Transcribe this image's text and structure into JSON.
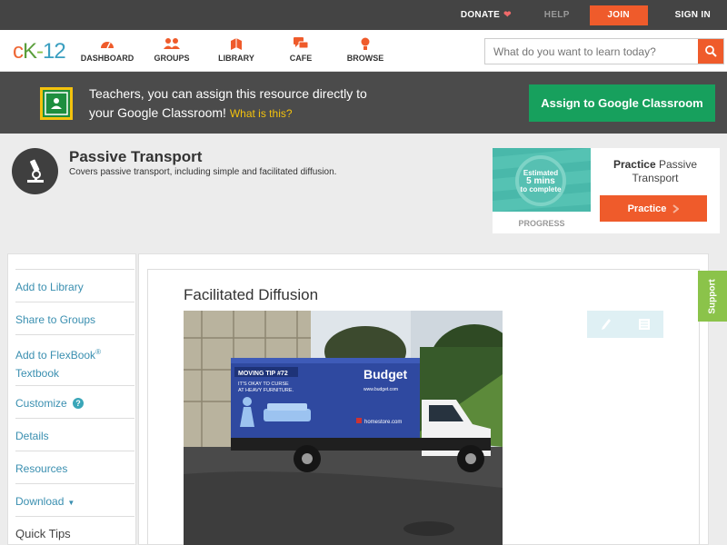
{
  "topbar": {
    "donate": "DONATE",
    "help": "HELP",
    "join": "JOIN",
    "sign_in": "SIGN IN"
  },
  "logo": {
    "part1": "c",
    "part2": "K",
    "part3": "-",
    "part4": "12"
  },
  "nav": {
    "items": [
      {
        "label": "DASHBOARD",
        "icon": "dashboard-icon"
      },
      {
        "label": "GROUPS",
        "icon": "groups-icon"
      },
      {
        "label": "LIBRARY",
        "icon": "library-icon"
      },
      {
        "label": "CAFE",
        "icon": "cafe-icon"
      },
      {
        "label": "BROWSE",
        "icon": "browse-icon"
      }
    ]
  },
  "search": {
    "placeholder": "What do you want to learn today?",
    "icon": "search-icon"
  },
  "banner": {
    "line1": "Teachers, you can assign this resource directly to",
    "line2": "your Google Classroom!",
    "what": "What is this?",
    "button": "Assign to Google Classroom"
  },
  "concept": {
    "icon": "microscope-icon",
    "title": "Passive Transport",
    "description": "Covers passive transport, including simple and facilitated diffusion."
  },
  "practice": {
    "circle_line1": "Estimated",
    "circle_line2": "5 mins",
    "circle_line3": "to complete",
    "progress_label": "PROGRESS",
    "title_bold": "Practice",
    "title_rest": "Passive Transport",
    "button": "Practice"
  },
  "sidebar": {
    "add_library": "Add to Library",
    "share_groups": "Share to Groups",
    "add_flexbook": "Add to FlexBook",
    "flexbook_reg": "®",
    "textbook": "Textbook",
    "customize": "Customize",
    "customize_help": "?",
    "details": "Details",
    "resources": "Resources",
    "download": "Download",
    "download_caret": "▼",
    "quick_tips": "Quick Tips"
  },
  "content": {
    "title": "Facilitated Diffusion",
    "tools": [
      "edit-pencil-icon",
      "notes-icon"
    ]
  },
  "photo": {
    "sign_tip": "MOVING TIP #72",
    "sign_line1": "IT'S OKAY TO CURSE",
    "sign_line2": "AT HEAVY FURNITURE.",
    "brand": "Budget",
    "brand_url": "www.budget.com",
    "partner": "homestore.com",
    "colors": {
      "truck_blue": "#2f49a0",
      "sky": "#d6dde4",
      "road": "#4a4a4a"
    }
  },
  "support": "Support",
  "colors": {
    "accent": "#ef5b2b",
    "link": "#3a8fb0",
    "green": "#17a05d",
    "dark_bar": "#4b4b4b"
  }
}
